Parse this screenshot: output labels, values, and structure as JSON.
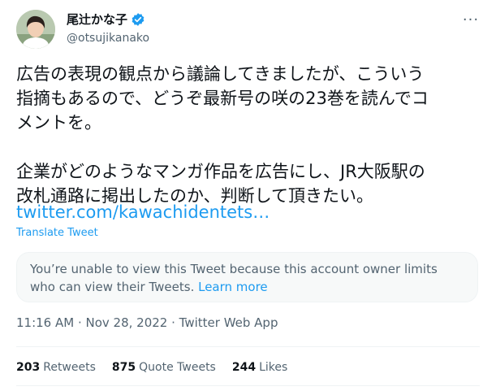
{
  "author": {
    "display_name": "尾辻かな子",
    "handle": "@otsujikanako",
    "verified_icon": "verified-badge-icon",
    "verified_color": "#1d9bf0"
  },
  "tweet": {
    "text": "広告の表現の観点から議論してきましたが、こういう\n指摘もあるので、どうぞ最新号の咲の23巻を読んでコ\nメントを。\n\n企業がどのようなマンガ作品を広告にし、JR大阪駅の\n改札通路に掲出したのか、判断して頂きたい。",
    "link": "twitter.com/kawachidentets…",
    "translate_label": "Translate Tweet"
  },
  "notice": {
    "text": "You’re unable to view this Tweet because this account owner limits who can view their Tweets. ",
    "link_label": "Learn more"
  },
  "meta": {
    "timestamp": "11:16 AM · Nov 28, 2022 · Twitter Web App"
  },
  "stats": {
    "retweets": "203",
    "retweets_label": "Retweets",
    "quotes": "875",
    "quotes_label": "Quote Tweets",
    "likes": "244",
    "likes_label": "Likes"
  },
  "colors": {
    "link": "#1d9bf0",
    "secondary_text": "#536471",
    "primary_text": "#0f1419"
  }
}
